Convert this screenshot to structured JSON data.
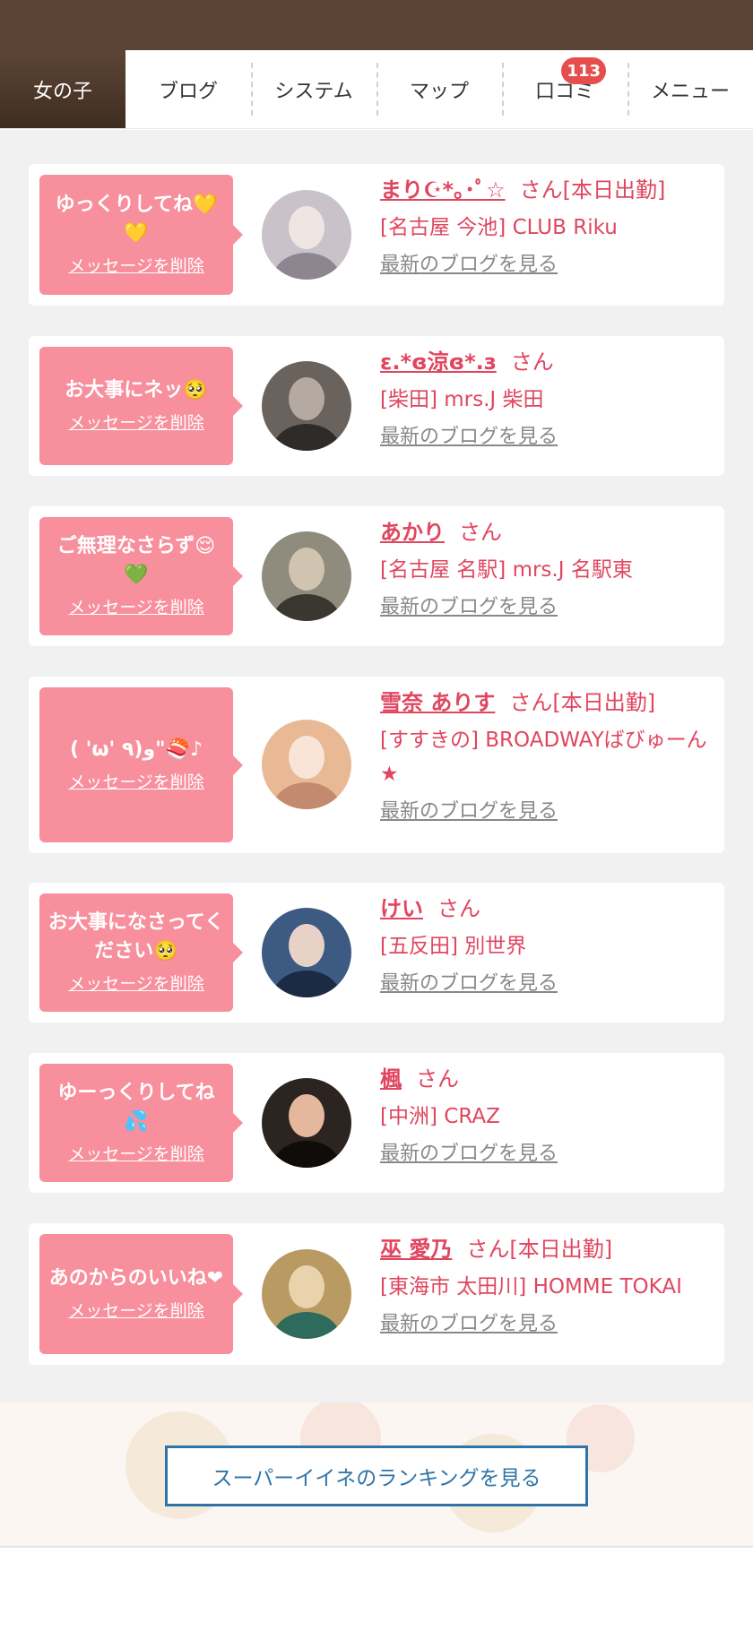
{
  "nav": {
    "tabs": [
      {
        "label": "女の子",
        "active": true
      },
      {
        "label": "ブログ"
      },
      {
        "label": "システム"
      },
      {
        "label": "マップ"
      },
      {
        "label": "口コミ",
        "badge": "113"
      },
      {
        "label": "メニュー"
      }
    ]
  },
  "common": {
    "delete_label": "メッセージを削除",
    "blog_label": "最新のブログを見る",
    "san": "さん"
  },
  "messages": [
    {
      "message": "ゆっくりしてね💛💛",
      "name": "まり☪*｡･ﾟ☆",
      "status": "[本日出勤]",
      "shop": "[名古屋 今池] CLUB Riku",
      "avatar_colors": [
        "#c9c2c9",
        "#efe6e4",
        "#8d8691"
      ]
    },
    {
      "message": "お大事にネッ🥺",
      "name": "ε.*ɞ涼ɞ*.з",
      "status": "",
      "shop": "[柴田] mrs.J 柴田",
      "avatar_colors": [
        "#6a625c",
        "#b5aaa2",
        "#2f2b29"
      ]
    },
    {
      "message": "ご無理なさらず😌💚",
      "name": "あかり",
      "status": "",
      "shop": "[名古屋 名駅] mrs.J 名駅東",
      "avatar_colors": [
        "#8f8c7e",
        "#d0c4b0",
        "#3a3630"
      ]
    },
    {
      "message": "( 'ω' ٩)و\"🍣♪",
      "name": "雪奈 ありす",
      "status": "[本日出勤]",
      "shop": "[すすきの] BROADWAYばびゅーん★",
      "avatar_colors": [
        "#e9b996",
        "#f8e5d8",
        "#c48a70"
      ]
    },
    {
      "message": "お大事になさってください🥺",
      "name": "けい",
      "status": "",
      "shop": "[五反田] 別世界",
      "avatar_colors": [
        "#3c5a82",
        "#e8d2c8",
        "#1c2a44"
      ]
    },
    {
      "message": "ゆーっくりしてね💦",
      "name": "楓",
      "status": "",
      "shop": "[中洲] CRAZ",
      "avatar_colors": [
        "#2c2420",
        "#e5b89e",
        "#0f0c0a"
      ]
    },
    {
      "message": "あのからのいいね❤",
      "name": "巫 愛乃",
      "status": "[本日出勤]",
      "shop": "[東海市 太田川] HOMME TOKAI",
      "avatar_colors": [
        "#b89a62",
        "#e9d3ad",
        "#2f6b5c"
      ]
    }
  ],
  "footer": {
    "ranking_button": "スーパーイイネのランキングを見る"
  }
}
